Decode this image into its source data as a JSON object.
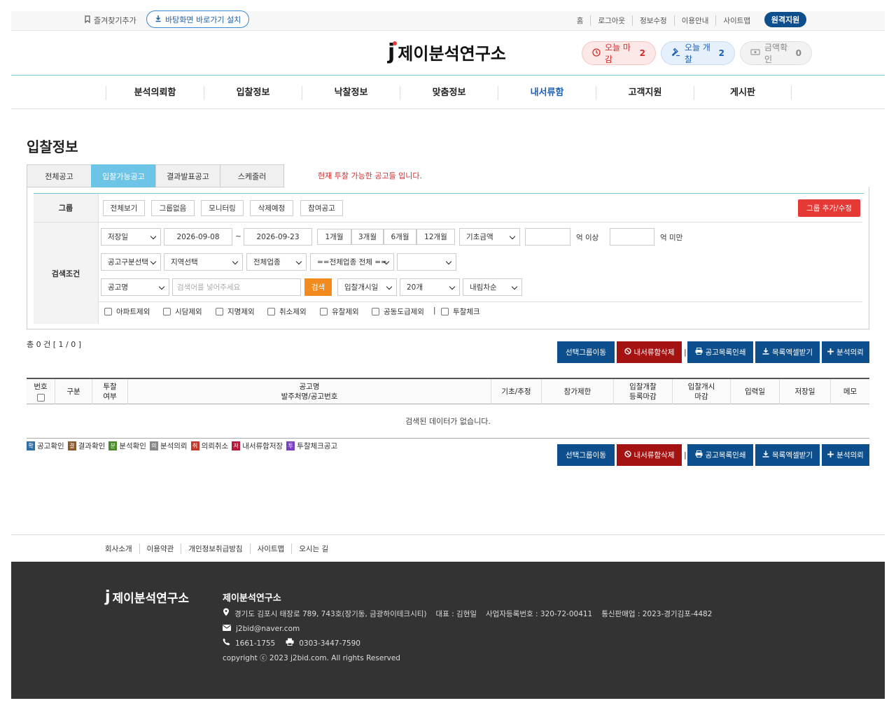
{
  "topbar": {
    "favorite": "즐겨찾기추가",
    "shortcut": "바탕화면 바로가기 설치",
    "links": [
      "홈",
      "로그아웃",
      "정보수정",
      "이용안내",
      "사이트맵"
    ],
    "remote": "원격지원"
  },
  "header": {
    "logo": "제이분석연구소",
    "pills": [
      {
        "label": "오늘 마감",
        "count": "2"
      },
      {
        "label": "오늘 개찰",
        "count": "2"
      },
      {
        "label": "금액확인",
        "count": "0"
      }
    ]
  },
  "nav": [
    "분석의뢰함",
    "입찰정보",
    "낙찰정보",
    "맞춤정보",
    "내서류함",
    "고객지원",
    "게시판"
  ],
  "page": {
    "title": "입찰정보",
    "tabs": [
      "전체공고",
      "입찰가능공고",
      "결과발표공고",
      "스케줄러"
    ],
    "note": "현재 투찰 가능한 공고들 입니다."
  },
  "search": {
    "group_label": "그룹",
    "group_buttons": [
      "전체보기",
      "그룹없음",
      "모니터링",
      "삭제예정",
      "참여공고"
    ],
    "add_group": "그룹 추가/수정",
    "cond_label": "검색조건",
    "date_type": "저장일",
    "date_from": "2026-09-08",
    "tilde": "~",
    "date_to": "2026-09-23",
    "periods": [
      "1개월",
      "3개월",
      "6개월",
      "12개월"
    ],
    "amount_type": "기초금액",
    "amount_min_unit": "억 이상",
    "amount_max_unit": "억 미만",
    "row2": [
      "공고구분선택",
      "지역선택",
      "전체업종",
      "==전체업종 전체 =="
    ],
    "keyword_type": "공고명",
    "keyword_placeholder": "검색어를 넣어주세요",
    "search_btn": "검색",
    "sort": "입찰개시일",
    "page_size": "20개",
    "order": "내림차순",
    "checks": [
      "아파트제외",
      "시담제외",
      "지명제외",
      "취소제외",
      "유찰제외",
      "공동도급제외",
      "투찰체크"
    ],
    "pipe": "|"
  },
  "results": {
    "count": "총 0 건 [ 1 / 0 ]",
    "actions": [
      "선택그룹이동",
      "내서류함삭제",
      "공고목록인쇄",
      "목록엑셀받기",
      "분석의뢰"
    ],
    "pipe": "|",
    "columns": [
      [
        "번호"
      ],
      [
        "구분"
      ],
      [
        "투찰",
        "여부"
      ],
      [
        "공고명",
        "발주처명/공고번호"
      ],
      [
        "기초/추정"
      ],
      [
        "참가제한"
      ],
      [
        "입찰개찰",
        "등록마감"
      ],
      [
        "입찰개시",
        "마감"
      ],
      [
        "입력일"
      ],
      [
        "저장일"
      ],
      [
        "메모"
      ]
    ],
    "empty": "검색된 데이터가 없습니다.",
    "legend": [
      {
        "mark": "확",
        "label": "공고확인",
        "color": "#2e6ea6"
      },
      {
        "mark": "결",
        "label": "결과확인",
        "color": "#8a5a2b"
      },
      {
        "mark": "분",
        "label": "분석확인",
        "color": "#4a8a2a"
      },
      {
        "mark": "의",
        "label": "분석의뢰",
        "color": "#888888"
      },
      {
        "mark": "취",
        "label": "의뢰취소",
        "color": "#c0392b"
      },
      {
        "mark": "저",
        "label": "내서류함저장",
        "color": "#b31b3a"
      },
      {
        "mark": "투",
        "label": "투찰체크공고",
        "color": "#7b3fc4"
      }
    ]
  },
  "footer": {
    "links": [
      "회사소개",
      "이용약관",
      "개인정보취급방침",
      "사이트맵",
      "오시는 길"
    ],
    "logo": "제이분석연구소",
    "name": "제이분석연구소",
    "address": "경기도 김포시 태장로 789, 743호(장기동, 금광하이테크시티)",
    "ceo": "대표 : 김현일",
    "biz": "사업자등록번호 : 320-72-00411",
    "mail_order": "통신판매업 : 2023-경기김포-4482",
    "email": "j2bid@naver.com",
    "phone": "1661-1755",
    "fax": "0303-3447-7590",
    "copyright": "copyright ⓒ 2023 j2bid.com. All rights Reserved"
  }
}
